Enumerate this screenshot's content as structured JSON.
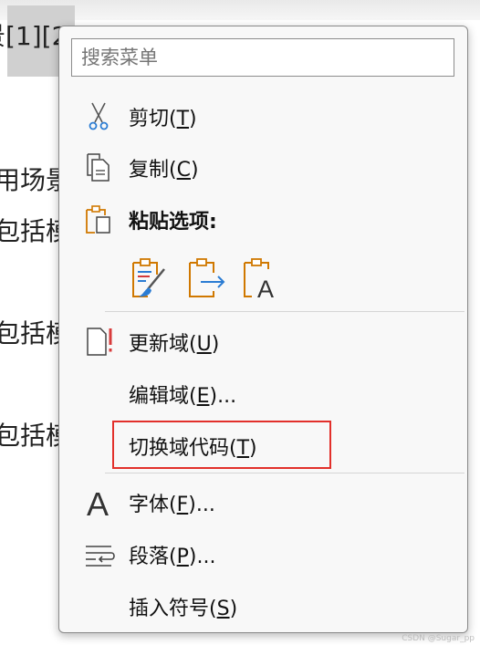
{
  "document": {
    "ref_text": "景[1][2",
    "lines": [
      "用场景",
      "包括模",
      "包括模",
      "包括模"
    ]
  },
  "menu": {
    "search": {
      "placeholder": "搜索菜单"
    },
    "items": {
      "cut": {
        "text": "剪切(",
        "key": "T",
        "tail": ")",
        "icon": "scissors-icon"
      },
      "copy": {
        "text": "复制(",
        "key": "C",
        "tail": ")",
        "icon": "copy-icon"
      },
      "paste_header": {
        "text": "粘贴选项:",
        "icon": "paste-icon"
      },
      "update_field": {
        "text": "更新域(",
        "key": "U",
        "tail": ")",
        "icon": "update-field-icon"
      },
      "edit_field": {
        "text": "编辑域(",
        "key": "E",
        "tail": ")..."
      },
      "toggle_field_codes": {
        "text": "切换域代码(",
        "key": "T",
        "tail": ")"
      },
      "font": {
        "text": "字体(",
        "key": "F",
        "tail": ")...",
        "icon": "font-icon"
      },
      "paragraph": {
        "text": "段落(",
        "key": "P",
        "tail": ")...",
        "icon": "paragraph-icon"
      },
      "insert_symbol": {
        "text": "插入符号(",
        "key": "S",
        "tail": ")"
      }
    },
    "paste_options": [
      {
        "name": "keep-source-formatting",
        "icon": "paste-keep-formatting-icon"
      },
      {
        "name": "merge-formatting",
        "icon": "paste-merge-formatting-icon"
      },
      {
        "name": "keep-text-only",
        "icon": "paste-text-only-icon",
        "glyph": "A"
      }
    ],
    "highlight_color": "#e2302b"
  },
  "watermark": "CSDN @Sugar_pp"
}
